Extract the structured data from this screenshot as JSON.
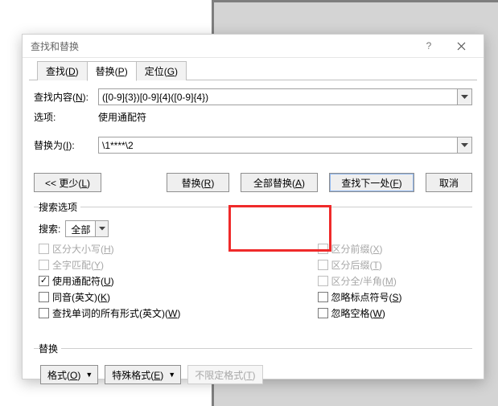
{
  "window": {
    "title": "查找和替换",
    "help": "?",
    "close": "×"
  },
  "tabs": {
    "find": {
      "label": "查找(",
      "key": "D",
      "tail": ")"
    },
    "replace": {
      "label": "替换(",
      "key": "P",
      "tail": ")"
    },
    "goto": {
      "label": "定位(",
      "key": "G",
      "tail": ")"
    }
  },
  "fields": {
    "find_label": "查找内容(",
    "find_key": "N",
    "find_tail": "):",
    "find_value": "([0-9]{3})[0-9]{4}([0-9]{4})",
    "options_label": "选项:",
    "options_value": "使用通配符",
    "replace_label": "替换为(",
    "replace_key": "I",
    "replace_tail": "):",
    "replace_value": "\\1****\\2"
  },
  "buttons": {
    "less": "<< 更少(",
    "less_key": "L",
    "less_tail": ")",
    "replace": "替换(",
    "replace_key": "R",
    "replace_tail": ")",
    "replace_all": "全部替换(",
    "replace_all_key": "A",
    "replace_all_tail": ")",
    "find_next": "查找下一处(",
    "find_next_key": "F",
    "find_next_tail": ")",
    "cancel": "取消"
  },
  "search_options": {
    "legend": "搜索选项",
    "search_label": "搜索:",
    "search_value": "全部",
    "left": [
      {
        "text": "区分大小写(",
        "key": "H",
        "tail": ")",
        "checked": false,
        "disabled": true
      },
      {
        "text": "全字匹配(",
        "key": "Y",
        "tail": ")",
        "checked": false,
        "disabled": true
      },
      {
        "text": "使用通配符(",
        "key": "U",
        "tail": ")",
        "checked": true,
        "disabled": false
      },
      {
        "text": "同音(英文)(",
        "key": "K",
        "tail": ")",
        "checked": false,
        "disabled": false
      },
      {
        "text": "查找单词的所有形式(英文)(",
        "key": "W",
        "tail": ")",
        "checked": false,
        "disabled": false
      }
    ],
    "right": [
      {
        "text": "区分前缀(",
        "key": "X",
        "tail": ")",
        "checked": false,
        "disabled": true
      },
      {
        "text": "区分后缀(",
        "key": "T",
        "tail": ")",
        "checked": false,
        "disabled": true
      },
      {
        "text": "区分全/半角(",
        "key": "M",
        "tail": ")",
        "checked": false,
        "disabled": true
      },
      {
        "text": "忽略标点符号(",
        "key": "S",
        "tail": ")",
        "checked": false,
        "disabled": false
      },
      {
        "text": "忽略空格(",
        "key": "W",
        "tail": ")",
        "checked": false,
        "disabled": false
      }
    ]
  },
  "replace_group": {
    "legend": "替换",
    "format": "格式(",
    "format_key": "O",
    "format_tail": ")",
    "special": "特殊格式(",
    "special_key": "E",
    "special_tail": ")",
    "noformat": "不限定格式(",
    "noformat_key": "T",
    "noformat_tail": ")"
  }
}
